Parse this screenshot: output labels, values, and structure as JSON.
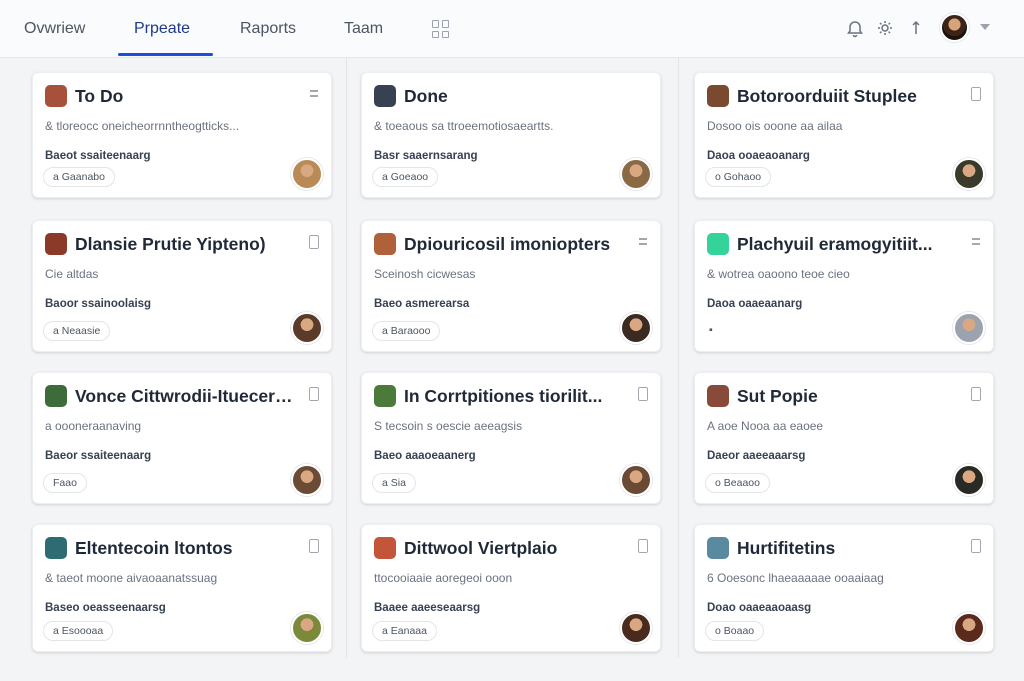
{
  "nav": {
    "tabs": [
      {
        "label": "Ovwriew",
        "active": false
      },
      {
        "label": "Prpeate",
        "active": true
      },
      {
        "label": "Raports",
        "active": false
      },
      {
        "label": "Taam",
        "active": false
      }
    ],
    "icons": [
      "bell-icon",
      "gear-icon",
      "pin-icon"
    ],
    "accent": "#1d4ed8"
  },
  "columns": [
    {
      "cards": [
        {
          "title": "To Do",
          "desc": "& tloreocc oneicheorrnntheogtticks...",
          "meta": "Baeot ssaiteenaarg",
          "tag": "a Gaanabo",
          "icon_color": "#a8513a",
          "menu": "lines",
          "avatar_color": "#b98a55"
        },
        {
          "title": "Dlansie Prutie Yipteno)",
          "desc": "Cie altdas",
          "meta": "Baoor ssainoolaisg",
          "tag": "a Neaasie",
          "icon_color": "#8b3a2a",
          "menu": "box",
          "avatar_color": "#5a3b2a"
        },
        {
          "title": "Vonce Cittwrodii-Ituecert...",
          "desc": "a oooneraanaving",
          "meta": "Baeor ssaiteenaarg",
          "tag": "Faao",
          "icon_color": "#3d6b3a",
          "menu": "box",
          "avatar_color": "#6b4a36"
        },
        {
          "title": "Eltentecoin ltontos",
          "desc": "& taeot moone aivaoaanatssuag",
          "meta": "Baseo oeasseenaarsg",
          "tag": "a Esoooaa",
          "icon_color": "#2f6b72",
          "menu": "box",
          "avatar_color": "#7a8a3a"
        }
      ]
    },
    {
      "cards": [
        {
          "title": "Done",
          "desc": "& toeaous sa ttroeemotiosaeartts.",
          "meta": "Basr saaernsarang",
          "tag": "a Goeaoo",
          "icon_color": "#374151",
          "menu": "none",
          "avatar_color": "#8a6a44"
        },
        {
          "title": "Dpiouricosil imoniopters",
          "desc": "Sceinosh cicwesas",
          "meta": "Baeo asmerearsa",
          "tag": "a Baraooo",
          "icon_color": "#b0603a",
          "menu": "lines",
          "avatar_color": "#3a2a22"
        },
        {
          "title": "In Corrtpitiones tiorilit...",
          "desc": "S tecsoin s oescie aeeagsis",
          "meta": "Baeo aaaoeaanerg",
          "tag": "a Sia",
          "icon_color": "#4b7a3a",
          "menu": "box",
          "avatar_color": "#6a4a34"
        },
        {
          "title": "Dittwool Viertplaio",
          "desc": "ttocooiaaie aoregeoi ooon",
          "meta": "Baaee aaeeseaarsg",
          "tag": "a Eanaaa",
          "icon_color": "#c2553a",
          "menu": "box",
          "avatar_color": "#4a2a1c"
        }
      ]
    },
    {
      "cards": [
        {
          "title": "Botoroorduiit Stuplee",
          "desc": "Dosoo ois ooone aa ailaa",
          "meta": "Daoa ooaeaoanarg",
          "tag": "o Gohaoo",
          "icon_color": "#7a4a30",
          "menu": "box",
          "avatar_color": "#3a3a2a"
        },
        {
          "title": "Plachyuil eramogyitiit...",
          "desc": "& wotrea oaoono teoe cieo",
          "meta": "Daoa oaaeaanarg",
          "tag": "",
          "icon_color": "#34d399",
          "menu": "lines",
          "avatar_color": "#9ca3af"
        },
        {
          "title": "Sut Popie",
          "desc": "A aoe Nooa aa eaoee",
          "meta": "Daeor aaeeaaarsg",
          "tag": "o Beaaoo",
          "icon_color": "#8a4a3a",
          "menu": "box",
          "avatar_color": "#2a2a24"
        },
        {
          "title": "Hurtifitetins",
          "desc": "6 Ooesonc lhaeaaaaae ooaaiaag",
          "meta": "Doao oaaeaaoaasg",
          "tag": "o Boaao",
          "icon_color": "#5a8aa0",
          "menu": "box",
          "avatar_color": "#5a2a1c"
        }
      ]
    }
  ]
}
